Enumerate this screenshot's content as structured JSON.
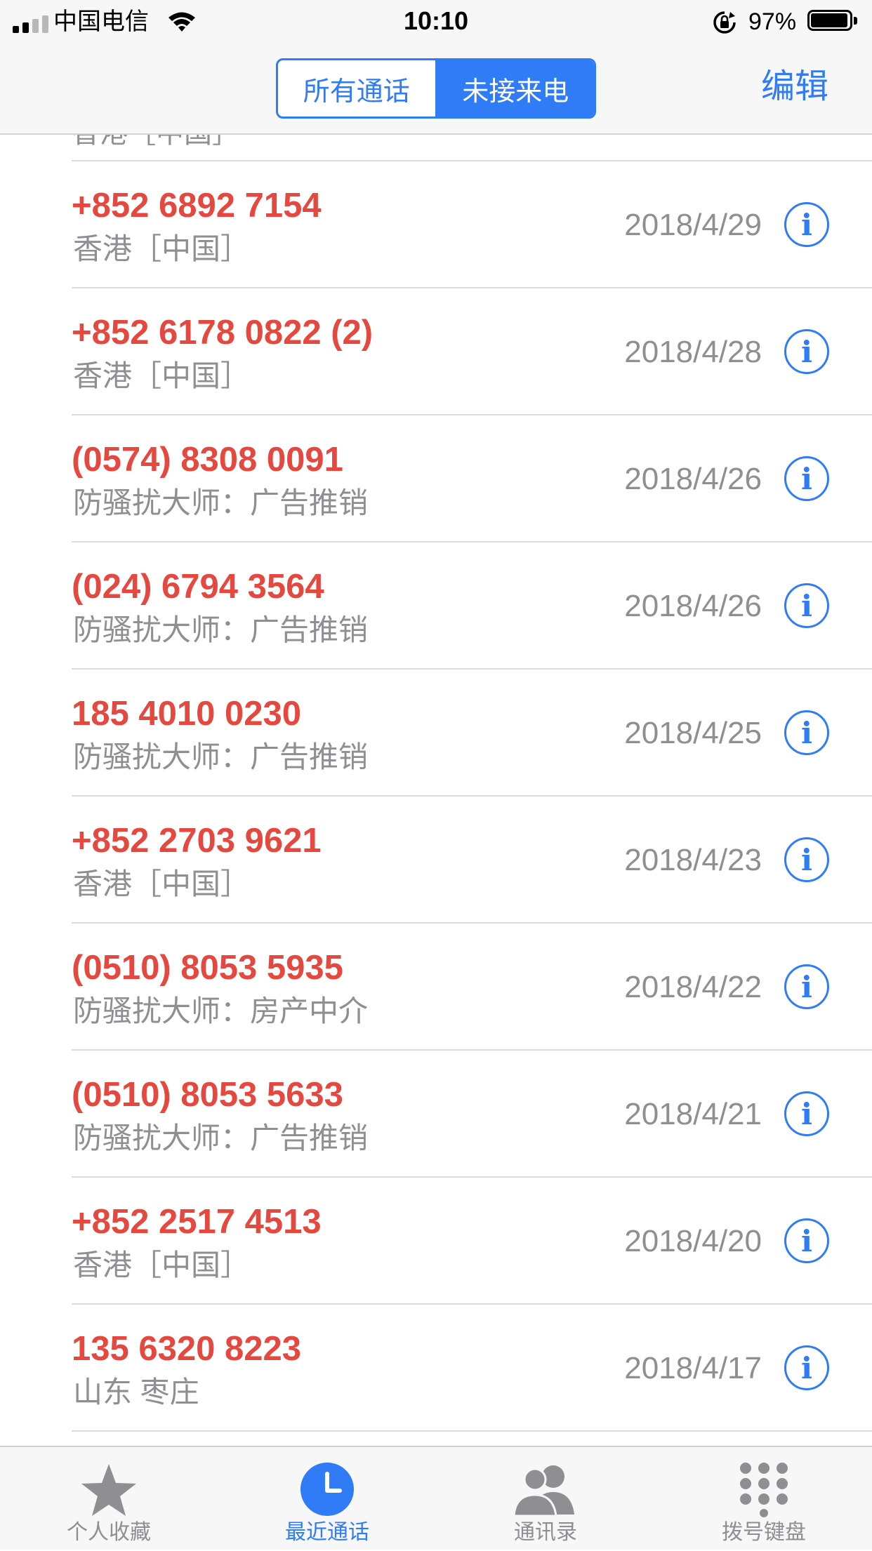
{
  "status_bar": {
    "carrier": "中国电信",
    "time": "10:10",
    "battery_percent": "97%",
    "battery_level": 0.97
  },
  "nav": {
    "segments": [
      "所有通话",
      "未接来电"
    ],
    "active_segment": "未接来电",
    "edit_label": "编辑"
  },
  "partial_row": {
    "subtitle": "香港［中国］"
  },
  "calls": [
    {
      "number": "+852 6892 7154",
      "subtitle": "香港［中国］",
      "date": "2018/4/29"
    },
    {
      "number": "+852 6178 0822 (2)",
      "subtitle": "香港［中国］",
      "date": "2018/4/28"
    },
    {
      "number": "(0574) 8308 0091",
      "subtitle": "防骚扰大师：广告推销",
      "date": "2018/4/26"
    },
    {
      "number": "(024) 6794 3564",
      "subtitle": "防骚扰大师：广告推销",
      "date": "2018/4/26"
    },
    {
      "number": "185 4010 0230",
      "subtitle": "防骚扰大师：广告推销",
      "date": "2018/4/25"
    },
    {
      "number": "+852 2703 9621",
      "subtitle": "香港［中国］",
      "date": "2018/4/23"
    },
    {
      "number": "(0510) 8053 5935",
      "subtitle": "防骚扰大师：房产中介",
      "date": "2018/4/22"
    },
    {
      "number": "(0510) 8053 5633",
      "subtitle": "防骚扰大师：广告推销",
      "date": "2018/4/21"
    },
    {
      "number": "+852 2517 4513",
      "subtitle": "香港［中国］",
      "date": "2018/4/20"
    },
    {
      "number": "135 6320 8223",
      "subtitle": "山东 枣庄",
      "date": "2018/4/17"
    }
  ],
  "info_glyph": "i",
  "tabs": [
    {
      "label": "个人收藏",
      "icon": "star-icon",
      "active": false
    },
    {
      "label": "最近通话",
      "icon": "clock-icon",
      "active": true
    },
    {
      "label": "通讯录",
      "icon": "contacts-icon",
      "active": false
    },
    {
      "label": "拨号键盘",
      "icon": "keypad-icon",
      "active": false
    }
  ],
  "colors": {
    "accent": "#2f7cf6",
    "missed_call": "#e5483f",
    "secondary_text": "#8e8e93",
    "tab_inactive": "#8e8e93"
  }
}
